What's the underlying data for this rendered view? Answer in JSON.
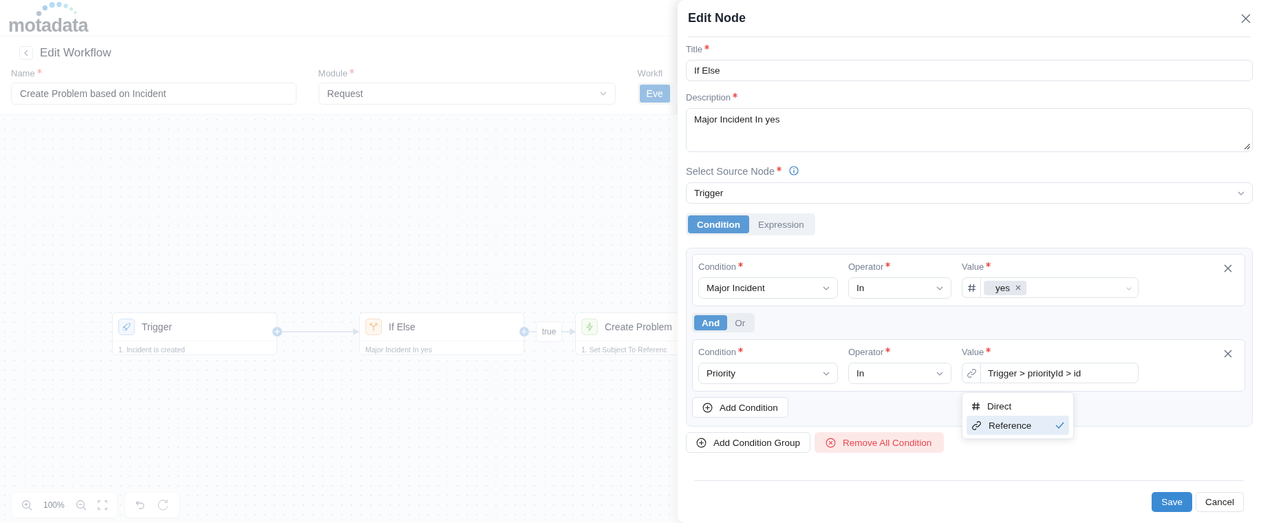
{
  "logo": {
    "text": "motadata"
  },
  "page": {
    "title": "Edit Workflow",
    "fields": [
      {
        "label": "Name",
        "required": true,
        "kind": "text",
        "value": "Create Problem based on Incident"
      },
      {
        "label": "Module",
        "required": true,
        "kind": "select",
        "value": "Request"
      }
    ],
    "field_3": {
      "label": "Workfl",
      "button": "Eve"
    }
  },
  "canvas": {
    "nodes": [
      {
        "kind": "trigger",
        "title": "Trigger",
        "subtitle": "1. Incident is created"
      },
      {
        "kind": "branch",
        "title": "If Else",
        "subtitle": "Major Incident In yes"
      },
      {
        "kind": "action",
        "title": "Create Problem",
        "subtitle": "1. Set Subject To Referenc"
      }
    ],
    "edge_label": "true",
    "zoom": "100%"
  },
  "panel": {
    "title": "Edit Node",
    "title_field": {
      "label": "Title",
      "required": true,
      "value": "If Else"
    },
    "description_field": {
      "label": "Description",
      "required": true,
      "value": "Major Incident In yes"
    },
    "source_field": {
      "label": "Select Source Node",
      "required": true,
      "value": "Trigger"
    },
    "tabs": [
      {
        "label": "Condition",
        "selected": true
      },
      {
        "label": "Expression",
        "selected": false
      }
    ],
    "conditions": [
      {
        "condition_label": "Condition",
        "operator_label": "Operator",
        "value_label": "Value",
        "condition": "Major Incident",
        "operator": "In",
        "kind": "direct",
        "tags": [
          "yes"
        ]
      },
      {
        "condition_label": "Condition",
        "operator_label": "Operator",
        "value_label": "Value",
        "condition": "Priority",
        "operator": "In",
        "kind": "reference",
        "value": "Trigger > priorityId > id"
      }
    ],
    "logic": [
      {
        "label": "And",
        "selected": true
      },
      {
        "label": "Or",
        "selected": false
      }
    ],
    "value_menu": {
      "items": [
        {
          "kind": "direct",
          "label": "Direct",
          "selected": false
        },
        {
          "kind": "reference",
          "label": "Reference",
          "selected": true
        }
      ]
    },
    "add_condition": "Add Condition",
    "add_group": "Add Condition Group",
    "remove_all": "Remove All Condition",
    "save": "Save",
    "cancel": "Cancel"
  }
}
